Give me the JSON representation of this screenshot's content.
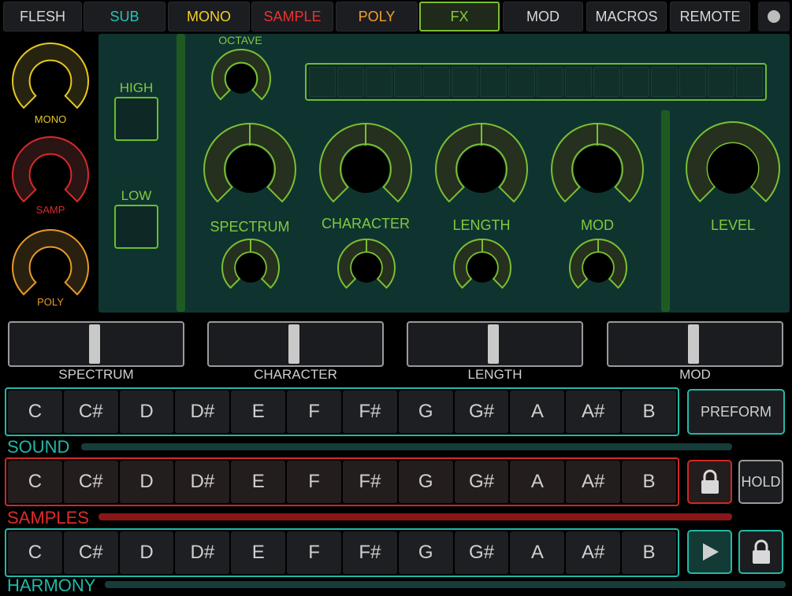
{
  "tabs": [
    {
      "label": "FLESH",
      "color": "#d8d8d8"
    },
    {
      "label": "SUB",
      "color": "#27c4b4"
    },
    {
      "label": "MONO",
      "color": "#f2d321"
    },
    {
      "label": "SAMPLE",
      "color": "#ef3030"
    },
    {
      "label": "POLY",
      "color": "#f0a030"
    },
    {
      "label": "FX",
      "color": "#86c93e"
    },
    {
      "label": "MOD",
      "color": "#d8d8d8"
    },
    {
      "label": "MACROS",
      "color": "#d8d8d8"
    },
    {
      "label": "REMOTE",
      "color": "#d8d8d8"
    }
  ],
  "mix_knobs": [
    {
      "label": "MONO",
      "color": "#e8c81e",
      "level": 1.0
    },
    {
      "label": "SAMP",
      "color": "#d82a2a",
      "level": 1.0
    },
    {
      "label": "POLY",
      "color": "#e89a2a",
      "level": 1.0
    }
  ],
  "fx": {
    "octave_label": "OCTAVE",
    "high_label": "HIGH",
    "low_label": "LOW",
    "knobs": [
      {
        "label": "SPECTRUM"
      },
      {
        "label": "CHARACTER"
      },
      {
        "label": "LENGTH"
      },
      {
        "label": "MOD"
      }
    ],
    "level_label": "LEVEL",
    "meter_segments": 16,
    "accent": "#7bbf32"
  },
  "sliders": [
    {
      "label": "SPECTRUM",
      "value": 0.5
    },
    {
      "label": "CHARACTER",
      "value": 0.5
    },
    {
      "label": "LENGTH",
      "value": 0.5
    },
    {
      "label": "MOD",
      "value": 0.5
    }
  ],
  "notes": [
    "C",
    "C#",
    "D",
    "D#",
    "E",
    "F",
    "F#",
    "G",
    "G#",
    "A",
    "A#",
    "B"
  ],
  "sections": {
    "sound": {
      "label": "SOUND",
      "color": "#22b8a8"
    },
    "samples": {
      "label": "SAMPLES",
      "color": "#e02a2a"
    },
    "harmony": {
      "label": "HARMONY",
      "color": "#22b8a8"
    }
  },
  "buttons": {
    "preform": "PREFORM",
    "hold": "HOLD"
  }
}
